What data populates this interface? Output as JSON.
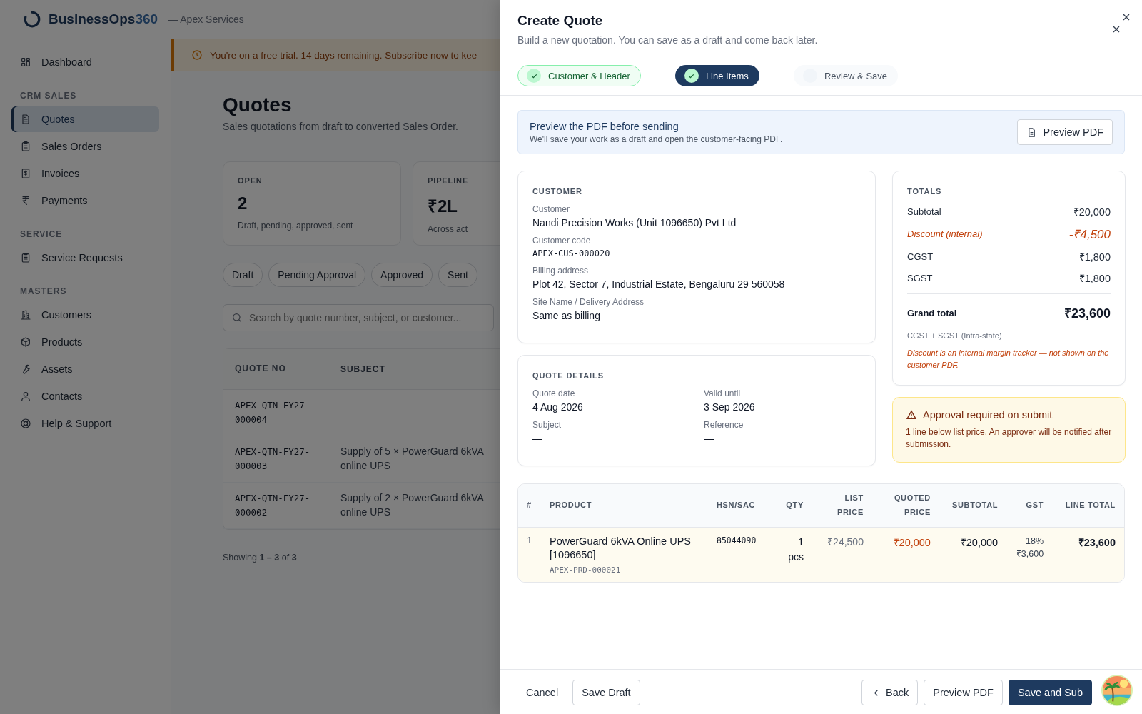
{
  "app": {
    "brand": "BusinessOps",
    "brand_accent": "360",
    "org": "— Apex Services"
  },
  "sidebar": {
    "groups": [
      {
        "items": [
          {
            "label": "Dashboard",
            "selected": false
          }
        ]
      },
      {
        "heading": "CRM SALES",
        "items": [
          {
            "label": "Quotes",
            "selected": true
          },
          {
            "label": "Sales Orders",
            "selected": false
          },
          {
            "label": "Invoices",
            "selected": false
          },
          {
            "label": "Payments",
            "selected": false
          }
        ]
      },
      {
        "heading": "SERVICE",
        "items": [
          {
            "label": "Service Requests",
            "selected": false
          }
        ]
      },
      {
        "heading": "MASTERS",
        "items": [
          {
            "label": "Customers",
            "selected": false
          },
          {
            "label": "Products",
            "selected": false
          },
          {
            "label": "Assets",
            "selected": false
          },
          {
            "label": "Contacts",
            "selected": false
          },
          {
            "label": "Help & Support",
            "selected": false
          }
        ]
      }
    ]
  },
  "trial_banner": "You're on a free trial. 14 days remaining. Subscribe now to kee",
  "page": {
    "title": "Quotes",
    "subtitle": "Sales quotations from draft to converted Sales Order."
  },
  "stats": [
    {
      "label": "OPEN",
      "value": "2",
      "note": "Draft, pending, approved, sent"
    },
    {
      "label": "PIPELINE",
      "value": "₹2L",
      "note": "Across act"
    }
  ],
  "filters": [
    {
      "label": "Draft",
      "selected": false
    },
    {
      "label": "Pending Approval",
      "selected": false
    },
    {
      "label": "Approved",
      "selected": false
    },
    {
      "label": "Sent",
      "selected": false
    }
  ],
  "search": {
    "placeholder": "Search by quote number, subject, or customer..."
  },
  "quotes_table": {
    "columns": [
      "QUOTE NO",
      "SUBJECT"
    ],
    "rows": [
      {
        "quote_no": "APEX-QTN-FY27-000004",
        "subject": "—"
      },
      {
        "quote_no": "APEX-QTN-FY27-000003",
        "subject": "Supply of 5 × PowerGuard 6kVA online UPS"
      },
      {
        "quote_no": "APEX-QTN-FY27-000002",
        "subject": "Supply of 2 × PowerGuard 6kVA online UPS"
      }
    ]
  },
  "pagination": "Showing **1 – 3** of **3**",
  "drawer": {
    "title": "Create Quote",
    "subtitle": "Build a new quotation. You can save as a draft and come back later.",
    "steps": [
      {
        "label": "Customer & Header",
        "complete": true,
        "selected": false
      },
      {
        "label": "Line Items",
        "complete": true,
        "selected": true
      },
      {
        "label": "Review & Save",
        "complete": false,
        "selected": false
      }
    ],
    "preview_banner": {
      "title": "Preview the PDF before sending",
      "text": "We'll save your work as a draft and open the customer-facing PDF.",
      "button": "Preview PDF"
    },
    "customer": {
      "heading": "CUSTOMER",
      "fields": [
        {
          "label": "Customer",
          "value": "Nandi Precision Works (Unit 1096650) Pvt Ltd",
          "kind": "text"
        },
        {
          "label": "Customer code",
          "value": "APEX-CUS-000020",
          "kind": "code"
        },
        {
          "label": "Billing address",
          "value": "Plot 42, Sector 7, Industrial Estate, Bengaluru 29 560058",
          "kind": "text"
        },
        {
          "label": "Site Name / Delivery Address",
          "value": "Same as billing",
          "kind": "text"
        }
      ]
    },
    "quote_details": {
      "heading": "QUOTE DETAILS",
      "fields": [
        {
          "label": "Quote date",
          "value": "4 Aug 2026"
        },
        {
          "label": "Valid until",
          "value": "3 Sep 2026"
        },
        {
          "label": "Subject",
          "value": "—"
        },
        {
          "label": "Reference",
          "value": "—"
        }
      ]
    },
    "totals": {
      "heading": "TOTALS",
      "lines": [
        {
          "label": "Subtotal",
          "value": "₹20,000",
          "kind": "normal"
        },
        {
          "label": "Discount (internal)",
          "value": "-₹4,500",
          "kind": "discount"
        },
        {
          "label": "CGST",
          "value": "₹1,800",
          "kind": "normal"
        },
        {
          "label": "SGST",
          "value": "₹1,800",
          "kind": "normal"
        }
      ],
      "grand_label": "Grand total",
      "grand_value": "₹23,600",
      "tax_note": "CGST + SGST (Intra-state)",
      "discount_note": "Discount is an internal margin tracker — not shown on the customer PDF."
    },
    "approval": {
      "title": "Approval required on submit",
      "text": "1 line below list price. An approver will be notified after submission."
    },
    "lines": {
      "columns": [
        "#",
        "PRODUCT",
        "HSN/SAC",
        "QTY",
        "LIST PRICE",
        "QUOTED PRICE",
        "SUBTOTAL",
        "GST",
        "LINE TOTAL"
      ],
      "rows": [
        {
          "no": "1",
          "product": "PowerGuard 6kVA Online UPS [1096650]",
          "code": "APEX-PRD-000021",
          "hsn": "85044090",
          "qty": "1",
          "unit": "pcs",
          "list_price": "₹24,500",
          "quoted_price": "₹20,000",
          "subtotal": "₹20,000",
          "gst_rate": "18%",
          "gst_amount": "₹3,600",
          "line_total": "₹23,600",
          "below_list_price": true
        }
      ]
    },
    "footer": {
      "cancel": "Cancel",
      "save_draft": "Save Draft",
      "back": "Back",
      "preview": "Preview PDF",
      "submit": "Save and Sub"
    }
  }
}
